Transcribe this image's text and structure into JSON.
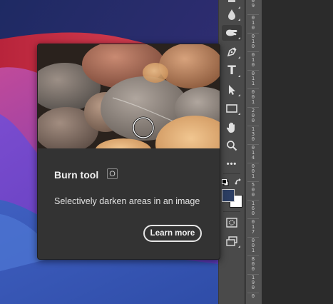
{
  "tooltip": {
    "title": "Burn tool",
    "shortcut": "O",
    "description": "Selectively darken areas in an image",
    "learn_more_label": "Learn more",
    "preview_image": "pebbles-photo"
  },
  "toolbar": {
    "tools": [
      {
        "name": "blur-tool",
        "icon": "drop-icon"
      },
      {
        "name": "burn-tool",
        "icon": "burn-hand-icon",
        "active": true
      },
      {
        "name": "pen-tool",
        "icon": "pen-icon"
      },
      {
        "name": "type-tool",
        "icon": "type-icon",
        "glyph": "T"
      },
      {
        "name": "path-selection-tool",
        "icon": "arrow-select-icon"
      },
      {
        "name": "rectangle-tool",
        "icon": "rectangle-icon"
      },
      {
        "name": "hand-tool",
        "icon": "hand-icon"
      },
      {
        "name": "zoom-tool",
        "icon": "magnifier-icon"
      },
      {
        "name": "edit-toolbar",
        "icon": "more-icon",
        "glyph": "•••"
      }
    ],
    "foreground_color": "#2c3e63",
    "background_color": "#ffffff"
  },
  "ruler": {
    "labels": [
      "0",
      "9",
      "0",
      "1",
      "0",
      "0",
      "1",
      "0",
      "0",
      "1",
      "0",
      "0",
      "1",
      "1",
      "0",
      "0",
      "1",
      "2",
      "0",
      "0",
      "1",
      "3",
      "0",
      "0",
      "1",
      "4",
      "0",
      "0",
      "1",
      "5",
      "0",
      "0",
      "1",
      "6",
      "0",
      "0",
      "1",
      "7",
      "0",
      "0",
      "1",
      "8",
      "0",
      "0",
      "1",
      "9",
      "0",
      "0"
    ]
  },
  "colors": {
    "toolbar_bg": "#4a4a4a",
    "card_bg": "#333333",
    "ruler_bg": "#535353",
    "canvas_bg": "#2b2b2b"
  }
}
